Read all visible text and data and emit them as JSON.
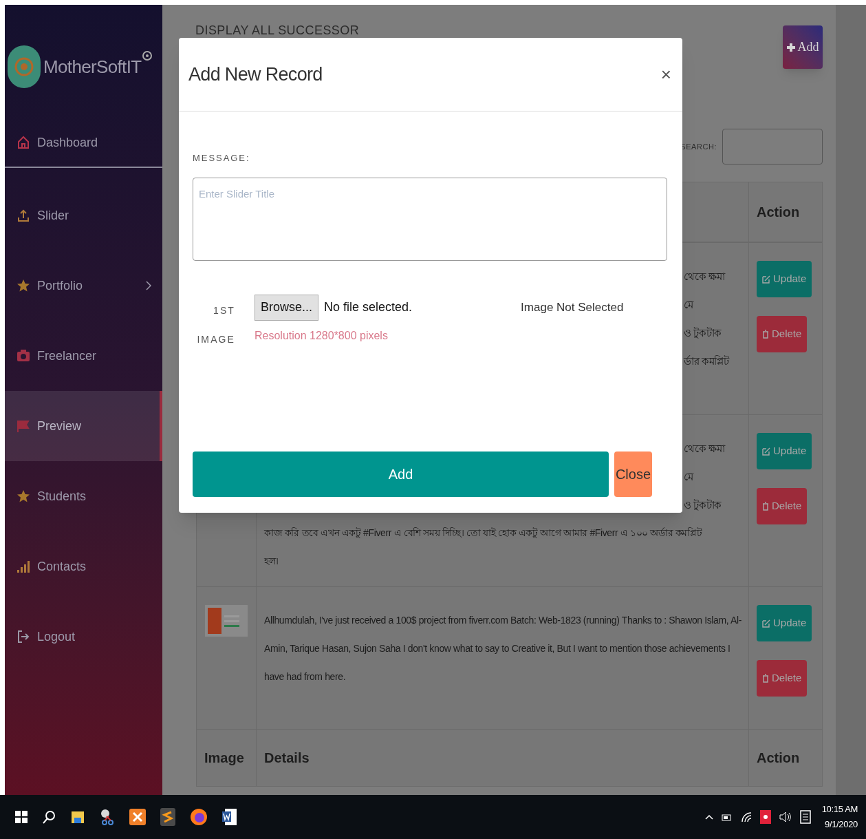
{
  "sidebar": {
    "brand": "MotherSoftIT",
    "items": [
      {
        "label": "Dashboard",
        "selected": false,
        "has_submenu": false
      },
      {
        "label": "Slider",
        "selected": false,
        "has_submenu": false
      },
      {
        "label": "Portfolio",
        "selected": false,
        "has_submenu": true
      },
      {
        "label": "Freelancer",
        "selected": false,
        "has_submenu": false
      },
      {
        "label": "Preview",
        "selected": true,
        "has_submenu": false
      },
      {
        "label": "Students",
        "selected": false,
        "has_submenu": false
      },
      {
        "label": "Contacts",
        "selected": false,
        "has_submenu": false
      },
      {
        "label": "Logout",
        "selected": false,
        "has_submenu": false
      }
    ]
  },
  "page": {
    "title": "DISPLAY ALL SUCCESSOR",
    "add_button": "Add",
    "search_label": "SEARCH:"
  },
  "table": {
    "header": [
      "Action"
    ],
    "rows": [
      {
        "thumbnail": false,
        "details": [
          {
            "kind": "fragment",
            "text": "থেকে ক্ষমা"
          },
          {
            "kind": "fragment",
            "text": "মে"
          },
          {
            "kind": "fragment",
            "text": "ও টুকটাক"
          },
          {
            "kind": "fragment",
            "text": "র্ডার কমপ্লিট"
          }
        ],
        "actions": [
          "Update",
          "Delete"
        ]
      },
      {
        "thumbnail": false,
        "details": [
          {
            "kind": "fragment",
            "text": "থেকে ক্ষমা"
          },
          {
            "kind": "fragment",
            "text": "মে"
          },
          {
            "kind": "fragment",
            "text": "ও টুকটাক"
          },
          {
            "kind": "full",
            "text": "কাজ করি তবে এখন একটু #Fiverr এ বেশি সময় দিচ্ছি। তো যাই হোক একটু আগে আমার #Fiverr এ ১০০ অর্ডার কমপ্লিট"
          },
          {
            "kind": "full",
            "text": "হল।"
          }
        ],
        "actions": [
          "Update",
          "Delete"
        ]
      },
      {
        "thumbnail": true,
        "details": [
          {
            "kind": "full",
            "text": "Allhumdulah, I've just received a 100$ project from fiverr.com Batch: Web-1823 (running) Thanks to : Shawon Islam, Al-Amin, Tarique Hasan, Sujon Saha I don't know what to say to Creative it, But I want to mention those achievements I have had from here."
          }
        ],
        "actions": [
          "Update",
          "Delete"
        ]
      }
    ],
    "footer": [
      "Image",
      "Details",
      "Action"
    ]
  },
  "modal": {
    "title": "Add New Record",
    "close": "×",
    "message_label": "MESSAGE:",
    "placeholder": "Enter Slider Title",
    "file_label": "1ST IMAGE",
    "browse": "Browse...",
    "file_status": "No file selected.",
    "preview_status": "Image Not Selected",
    "hint": "Resolution 1280*800 pixels",
    "buttons": [
      {
        "kind": "primary",
        "label": "Add"
      },
      {
        "kind": "secondary",
        "label": "Close"
      }
    ]
  },
  "taskbar": {
    "time": "10:15 AM",
    "date": "9/1/2020"
  }
}
